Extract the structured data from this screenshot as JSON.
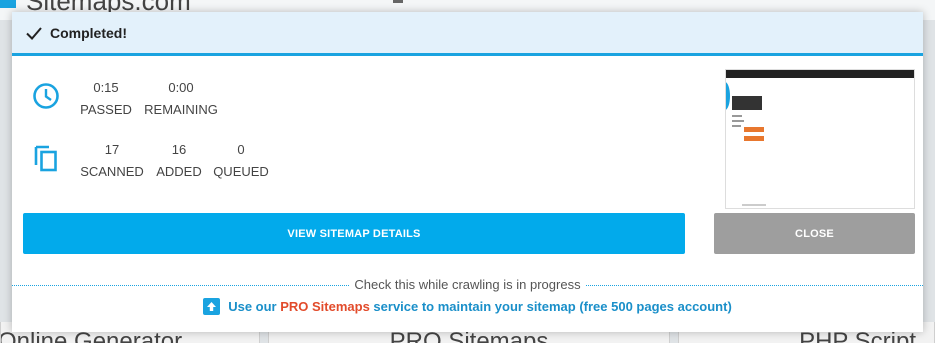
{
  "background": {
    "logo_text": "Sitemaps.com",
    "tabs": [
      "Online Generator",
      "PRO Sitemaps",
      "PHP Script"
    ]
  },
  "modal": {
    "header": {
      "title": "Completed!",
      "icon": "check-icon"
    },
    "time": {
      "icon": "clock-icon",
      "passed": {
        "value": "0:15",
        "label": "PASSED"
      },
      "remaining": {
        "value": "0:00",
        "label": "REMAINING"
      }
    },
    "pages": {
      "icon": "copy-pages-icon",
      "scanned": {
        "value": "17",
        "label": "SCANNED"
      },
      "added": {
        "value": "16",
        "label": "ADDED"
      },
      "queued": {
        "value": "0",
        "label": "QUEUED"
      }
    },
    "buttons": {
      "details": "VIEW SITEMAP DETAILS",
      "close": "CLOSE"
    },
    "promo": {
      "caption": "Check this while crawling is in progress",
      "prefix": "Use our ",
      "pro_link": "PRO Sitemaps",
      "suffix": " service to maintain your sitemap (free 500 pages account)",
      "icon": "upload-icon"
    }
  },
  "colors": {
    "accent": "#1aa3e0",
    "primary_button": "#02aaeb",
    "close_button": "#9e9e9e",
    "pro_highlight": "#e24b2b",
    "header_bg": "#e3f1fb"
  }
}
